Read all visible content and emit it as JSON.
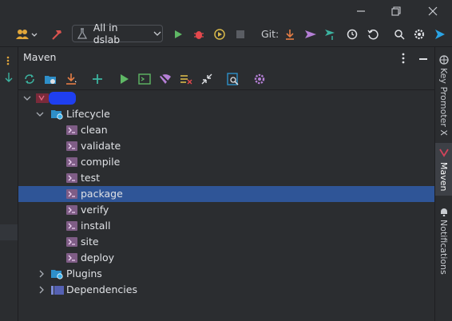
{
  "toolbar": {
    "run_config": "All in dslab",
    "git_label": "Git:"
  },
  "panel": {
    "title": "Maven"
  },
  "tree": {
    "lifecycle": "Lifecycle",
    "goals": [
      "clean",
      "validate",
      "compile",
      "test",
      "package",
      "verify",
      "install",
      "site",
      "deploy"
    ],
    "selected_goal": "package",
    "plugins": "Plugins",
    "dependencies": "Dependencies"
  },
  "right_tabs": {
    "key_promoter": "Key Promoter X",
    "maven": "Maven",
    "notifications": "Notifications"
  },
  "colors": {
    "accent_selection": "#2f5597",
    "run_green": "#5fb865",
    "maven_red": "#d0435a"
  }
}
